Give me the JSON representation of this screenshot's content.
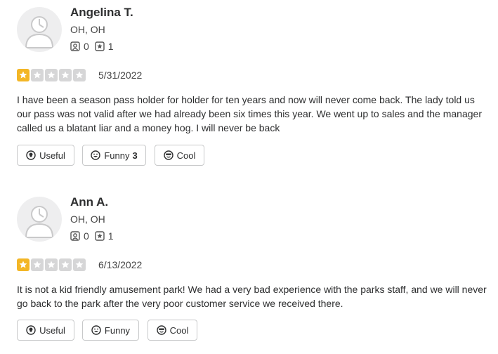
{
  "colors": {
    "star_filled": "#f3b626",
    "star_empty": "#d6d6d7",
    "avatar_bg": "#eeeeef"
  },
  "reviews": [
    {
      "name": "Angelina T.",
      "location": "OH, OH",
      "friends_count": "0",
      "reviews_count": "1",
      "rating": 1,
      "date": "5/31/2022",
      "text": "I have been a season pass holder for holder for ten years and now will never come back. The lady told us our pass was not valid after we had already been six times this year. We went up to sales and the manager called us a blatant liar and a money hog. I will never be back",
      "buttons": {
        "useful": "Useful",
        "funny": "Funny",
        "funny_count": "3",
        "cool": "Cool"
      },
      "icons": {
        "avatar": "user-avatar-icon",
        "friends": "friends-icon",
        "reviews": "review-star-icon"
      }
    },
    {
      "name": "Ann A.",
      "location": "OH, OH",
      "friends_count": "0",
      "reviews_count": "1",
      "rating": 1,
      "date": "6/13/2022",
      "text": "It is not a kid friendly amusement park! We had a very bad experience with the parks staff, and we will never go back to the park after the very poor customer service we received there.",
      "buttons": {
        "useful": "Useful",
        "funny": "Funny",
        "funny_count": "",
        "cool": "Cool"
      },
      "icons": {
        "avatar": "user-avatar-icon",
        "friends": "friends-icon",
        "reviews": "review-star-icon"
      }
    }
  ]
}
